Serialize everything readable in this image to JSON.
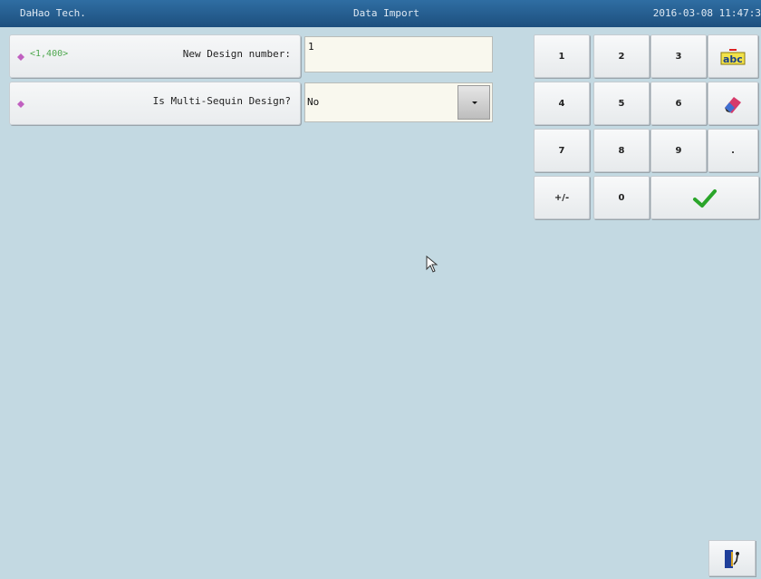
{
  "titlebar": {
    "company": "DaHao Tech.",
    "title": "Data Import",
    "datetime": "2016-03-08 11:47:3"
  },
  "params": [
    {
      "range": "<1,400>",
      "label": "New Design number:",
      "value": "1"
    },
    {
      "range": "",
      "label": "Is Multi-Sequin Design?",
      "value": "No"
    }
  ],
  "keypad": {
    "k1": "1",
    "k2": "2",
    "k3": "3",
    "k4": "4",
    "k5": "5",
    "k6": "6",
    "k7": "7",
    "k8": "8",
    "k9": "9",
    "kdot": ".",
    "kneg": "+/-",
    "k0": "0",
    "icons": {
      "abc": "abc-keyboard-icon",
      "clear": "eraser-icon",
      "confirm": "checkmark-icon"
    }
  },
  "footer": {
    "exit_icon": "exit-door-icon"
  },
  "colors": {
    "background": "#c3d9e2",
    "titlebar": "#1d4f7e",
    "range_text": "#4fa84f",
    "confirm": "#2aa52a",
    "diamond": "#c060c0"
  }
}
